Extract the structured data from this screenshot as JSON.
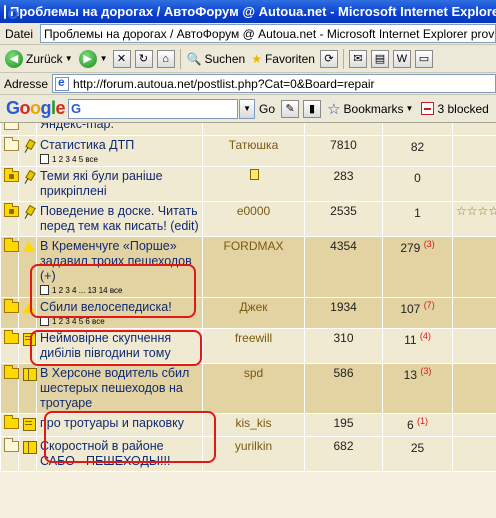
{
  "window": {
    "title": "Проблемы на дорогах / АвтоФорум @ Autoua.net - Microsoft Internet Explorer provided by"
  },
  "menubar": {
    "file_label": "Datei",
    "window_text": "Проблемы на дорогах / АвтоФорум @ Autoua.net - Microsoft Internet Explorer provided by"
  },
  "toolbar": {
    "back_label": "Zurück",
    "search_label": "Suchen",
    "favorites_label": "Favoriten"
  },
  "address": {
    "label": "Adresse",
    "url": "http://forum.autoua.net/postlist.php?Cat=0&Board=repair"
  },
  "googlebar": {
    "logo": [
      "G",
      "o",
      "o",
      "g",
      "l",
      "e"
    ],
    "go_label": "Go",
    "bookmarks_label": "Bookmarks",
    "blocked_label": "3 blocked"
  },
  "threads": [
    {
      "title": "Яндекс-map.",
      "author": "",
      "views": "",
      "replies": "",
      "new_replies": "",
      "pages": "",
      "row_style": "light",
      "folder": "plain",
      "icon": "none",
      "extra": "",
      "partial": true
    },
    {
      "title": "Статистика ДТП",
      "author": "Татюшка",
      "views": "7810",
      "replies": "82",
      "new_replies": "",
      "pages": "1 2 3 4 5 все",
      "row_style": "light",
      "folder": "plain",
      "icon": "pin",
      "extra": ""
    },
    {
      "title": "Теми які були раніше прикріплені",
      "author": "",
      "views": "283",
      "replies": "0",
      "new_replies": "",
      "pages": "",
      "row_style": "light",
      "folder": "lock",
      "icon": "pin",
      "extra": "",
      "author_icon": "moderator-icon"
    },
    {
      "title": "Поведение в доске. Читать перед тем как писать! (edit)",
      "author": "e0000",
      "views": "2535",
      "replies": "1",
      "new_replies": "",
      "pages": "",
      "row_style": "light",
      "folder": "lock",
      "icon": "pin",
      "extra": "☆☆☆☆☆"
    },
    {
      "title": "В Кременчуге «Порше» задавил троих пешеходов (+)",
      "author": "FORDMAX",
      "views": "4354",
      "replies": "279",
      "new_replies": "(3)",
      "pages": "1 2 3 4 ... 13 14 все",
      "row_style": "dark",
      "folder": "hot",
      "icon": "warn",
      "extra": ""
    },
    {
      "title": "Сбили велосепедиска!",
      "author": "Джек",
      "views": "1934",
      "replies": "107",
      "new_replies": "(7)",
      "pages": "1 2 3 4 5 6 все",
      "row_style": "dark",
      "folder": "hot",
      "icon": "warn",
      "extra": ""
    },
    {
      "title": "Неймовірне скупчення дибілів півгодини тому",
      "author": "freewill",
      "views": "310",
      "replies": "11",
      "new_replies": "(4)",
      "pages": "",
      "row_style": "light",
      "folder": "hot",
      "icon": "note",
      "extra": ""
    },
    {
      "title": "В Херсоне водитель сбил шестерых пешеходов на тротуаре",
      "author": "spd",
      "views": "586",
      "replies": "13",
      "new_replies": "(3)",
      "pages": "",
      "row_style": "dark",
      "folder": "hot",
      "icon": "book",
      "extra": ""
    },
    {
      "title": "про тротуары и парковку",
      "author": "kis_kis",
      "views": "195",
      "replies": "6",
      "new_replies": "(1)",
      "pages": "",
      "row_style": "light",
      "folder": "hot",
      "icon": "note",
      "extra": ""
    },
    {
      "title": "Скоростной в районе САБО - ПЕШЕХОДЫ!!!",
      "author": "yurilkin",
      "views": "682",
      "replies": "25",
      "new_replies": "",
      "pages": "",
      "row_style": "light",
      "folder": "plain",
      "icon": "book",
      "extra": ""
    }
  ]
}
